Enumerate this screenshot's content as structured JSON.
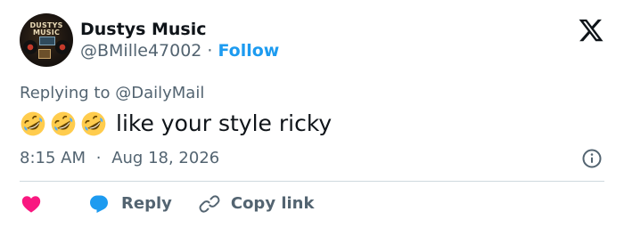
{
  "author": {
    "display_name": "Dustys Music",
    "handle": "@BMille47002",
    "separator": "·",
    "follow_label": "Follow",
    "avatar_text": "DUSTYS MUSIC"
  },
  "reply_context": {
    "prefix": "Replying to",
    "handle": "@DailyMail"
  },
  "tweet": {
    "emojis": [
      "rolling-on-floor-laughing",
      "rolling-on-floor-laughing",
      "rolling-on-floor-laughing"
    ],
    "text": "like your style ricky"
  },
  "meta": {
    "time": "8:15 AM",
    "separator": "·",
    "date": "Aug 18, 2026"
  },
  "actions": {
    "like_icon": "heart-icon",
    "reply_label": "Reply",
    "copy_label": "Copy link"
  },
  "colors": {
    "accent": "#1d9bf0",
    "like": "#f91880",
    "muted": "#536471",
    "text": "#0f1419",
    "divider": "#cfd9de"
  }
}
